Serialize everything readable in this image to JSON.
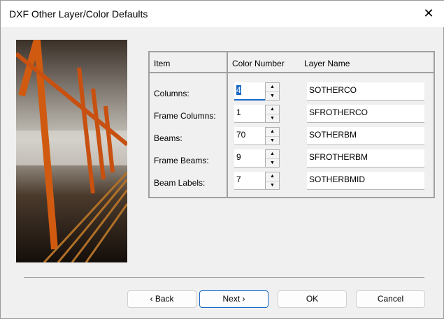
{
  "window": {
    "title": "DXF Other Layer/Color Defaults",
    "close_icon": "close-icon"
  },
  "table": {
    "headers": {
      "item": "Item",
      "color": "Color Number",
      "layer": "Layer Name"
    },
    "rows": [
      {
        "item": "Columns:",
        "color": "4",
        "layer": "SOTHERCO"
      },
      {
        "item": "Frame Columns:",
        "color": "1",
        "layer": "SFROTHERCO"
      },
      {
        "item": "Beams:",
        "color": "70",
        "layer": "SOTHERBM"
      },
      {
        "item": "Frame Beams:",
        "color": "9",
        "layer": "SFROTHERBM"
      },
      {
        "item": "Beam Labels:",
        "color": "7",
        "layer": "SOTHERBMID"
      }
    ],
    "spin_up": "▲",
    "spin_down": "▼"
  },
  "buttons": {
    "back": "‹ Back",
    "next": "Next ›",
    "ok": "OK",
    "cancel": "Cancel"
  },
  "colors": {
    "accent": "#1868c8"
  }
}
